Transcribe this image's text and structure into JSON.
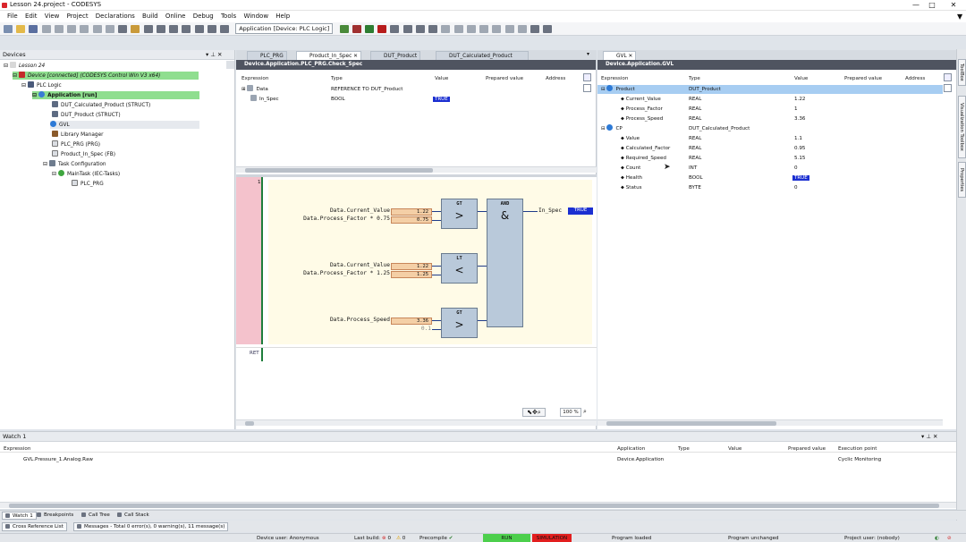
{
  "window": {
    "title": "Lesson 24.project - CODESYS",
    "minimize": "—",
    "maximize": "□",
    "close": "✕"
  },
  "menu": [
    "File",
    "Edit",
    "View",
    "Project",
    "Declarations",
    "Build",
    "Online",
    "Debug",
    "Tools",
    "Window",
    "Help"
  ],
  "toolbar": {
    "app_combo": "Application [Device: PLC Logic]"
  },
  "devices": {
    "title": "Devices",
    "items": [
      {
        "label": "Lesson 24",
        "icon": "project-icon",
        "color": "#ffffff"
      },
      {
        "label": "Device [connected] (CODESYS Control Win V3 x64)",
        "icon": "device-icon",
        "color": "#90e090"
      },
      {
        "label": "PLC Logic",
        "icon": "plc-logic-icon",
        "color": "#ffffff"
      },
      {
        "label": "Application [run]",
        "icon": "application-icon",
        "color": "#90e090"
      },
      {
        "label": "DUT_Calculated_Product (STRUCT)",
        "icon": "struct-icon",
        "color": "#ffffff"
      },
      {
        "label": "DUT_Product (STRUCT)",
        "icon": "struct-icon",
        "color": "#ffffff"
      },
      {
        "label": "GVL",
        "icon": "gvl-icon",
        "color": "#e6e9ee"
      },
      {
        "label": "Library Manager",
        "icon": "library-icon",
        "color": "#ffffff"
      },
      {
        "label": "PLC_PRG (PRG)",
        "icon": "program-icon",
        "color": "#ffffff"
      },
      {
        "label": "Product_In_Spec (FB)",
        "icon": "fb-icon",
        "color": "#ffffff"
      },
      {
        "label": "Task Configuration",
        "icon": "task-config-icon",
        "color": "#ffffff"
      },
      {
        "label": "MainTask (IEC-Tasks)",
        "icon": "task-icon",
        "color": "#ffffff"
      },
      {
        "label": "PLC_PRG",
        "icon": "program-call-icon",
        "color": "#ffffff"
      }
    ]
  },
  "editor_tabs": [
    "PLC_PRG",
    "Product_In_Spec",
    "DUT_Product",
    "DUT_Calculated_Product"
  ],
  "left_editor": {
    "header": "Device.Application.PLC_PRG.Check_Spec",
    "columns": [
      "Expression",
      "Type",
      "Value",
      "Prepared value",
      "Address"
    ],
    "rows": [
      {
        "expr": "Data",
        "type": "REFERENCE TO DUT_Product",
        "value": ""
      },
      {
        "expr": "In_Spec",
        "type": "BOOL",
        "value": "TRUE"
      }
    ]
  },
  "fbd": {
    "network_number": "1",
    "ret": "RET",
    "rung1": {
      "in1": "Data.Current_Value",
      "in1_val": "1.22",
      "in2": "Data.Process_Factor * 0.75",
      "in2_val": "0.75",
      "box": "GT",
      "symbol": ">"
    },
    "rung2": {
      "in1": "Data.Current_Value",
      "in1_val": "1.22",
      "in2": "Data.Process_Factor * 1.25",
      "in2_val": "1.25",
      "box": "LT",
      "symbol": "<"
    },
    "rung3": {
      "in1": "Data.Process_Speed",
      "in1_val": "3.36",
      "in2_val": "0.1",
      "box": "GT",
      "symbol": ">"
    },
    "and_box": {
      "name": "AND",
      "symbol": "&"
    },
    "output": {
      "name": "In_Spec",
      "value": "TRUE"
    },
    "zoom": "100 %"
  },
  "gvl_tab": "GVL",
  "right_editor": {
    "header": "Device.Application.GVL",
    "columns": [
      "Expression",
      "Type",
      "Value",
      "Prepared value",
      "Address"
    ],
    "rows": [
      {
        "expr": "Product",
        "type": "DUT_Product",
        "value": "",
        "level": 0,
        "selected": true
      },
      {
        "expr": "Current_Value",
        "type": "REAL",
        "value": "1.22",
        "level": 1
      },
      {
        "expr": "Process_Factor",
        "type": "REAL",
        "value": "1",
        "level": 1
      },
      {
        "expr": "Process_Speed",
        "type": "REAL",
        "value": "3.36",
        "level": 1
      },
      {
        "expr": "CP",
        "type": "DUT_Calculated_Product",
        "value": "",
        "level": 0
      },
      {
        "expr": "Value",
        "type": "REAL",
        "value": "1.1",
        "level": 1
      },
      {
        "expr": "Calculated_Factor",
        "type": "REAL",
        "value": "0.95",
        "level": 1
      },
      {
        "expr": "Required_Speed",
        "type": "REAL",
        "value": "5.15",
        "level": 1
      },
      {
        "expr": "Count",
        "type": "INT",
        "value": "0",
        "level": 1
      },
      {
        "expr": "Health",
        "type": "BOOL",
        "value": "TRUE",
        "level": 1
      },
      {
        "expr": "Status",
        "type": "BYTE",
        "value": "0",
        "level": 1
      }
    ]
  },
  "watch": {
    "title": "Watch 1",
    "columns": [
      "Expression",
      "Application",
      "Type",
      "Value",
      "Prepared value",
      "Execution point"
    ],
    "rows": [
      {
        "expr": "GVL.Pressure_1.Analog.Raw",
        "application": "Device.Application",
        "type": "",
        "value": "",
        "prepared": "",
        "exec": "Cyclic Monitoring"
      }
    ]
  },
  "bottom_tabs": [
    "Watch 1",
    "Breakpoints",
    "Call Tree",
    "Call Stack"
  ],
  "bottom_tabs2": [
    "Cross Reference List",
    "Messages - Total 0 error(s), 0 warning(s), 11 message(s)"
  ],
  "status": {
    "device_user": "Device user: Anonymous",
    "last_build": "Last build:",
    "errors": "0",
    "warnings": "0",
    "precompile": "Precompile",
    "run": "RUN",
    "simulation": "SIMULATION",
    "program_loaded": "Program loaded",
    "program_unchanged": "Program unchanged",
    "project_user": "Project user: (nobody)"
  },
  "side_tabs": [
    "ToolBox",
    "Visualization Toolbox",
    "Properties"
  ]
}
